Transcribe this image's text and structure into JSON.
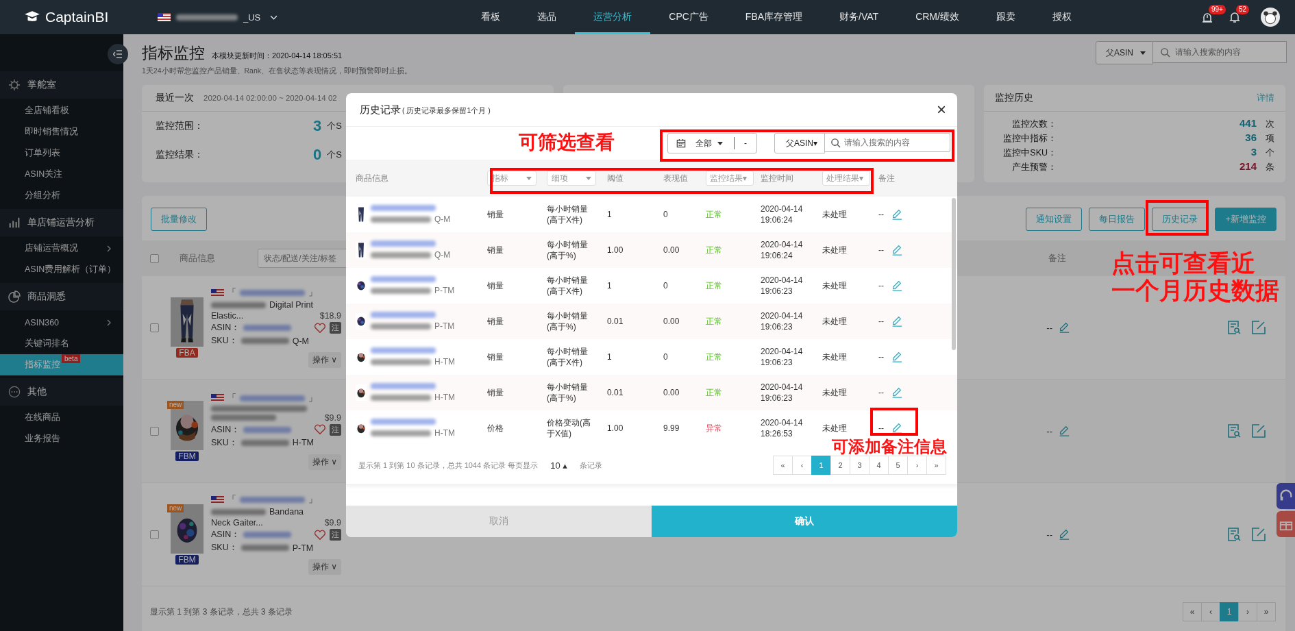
{
  "topbar": {
    "logo": "CaptainBI",
    "store_suffix": "_US",
    "nav": [
      {
        "label": "看板",
        "selected": false
      },
      {
        "label": "选品",
        "selected": false
      },
      {
        "label": "运营分析",
        "selected": true
      },
      {
        "label": "CPC广告",
        "selected": false
      },
      {
        "label": "FBA库存管理",
        "selected": false
      },
      {
        "label": "财务/VAT",
        "selected": false
      },
      {
        "label": "CRM/绩效",
        "selected": false
      },
      {
        "label": "跟卖",
        "selected": false
      },
      {
        "label": "授权",
        "selected": false
      }
    ],
    "badges": [
      "99+",
      "52"
    ]
  },
  "sidebar": {
    "groups": [
      {
        "label": "掌舵室",
        "kind": "helm",
        "children": [
          {
            "label": "全店铺看板",
            "selected": false,
            "expandable": false
          },
          {
            "label": "即时销售情况",
            "selected": false,
            "expandable": false
          },
          {
            "label": "订单列表",
            "selected": false,
            "expandable": false
          },
          {
            "label": "ASIN关注",
            "selected": false,
            "expandable": false
          },
          {
            "label": "分组分析",
            "selected": false,
            "expandable": false
          }
        ]
      },
      {
        "label": "单店铺运营分析",
        "kind": "bars",
        "children": [
          {
            "label": "店铺运营概况",
            "selected": false,
            "expandable": true
          },
          {
            "label": "ASIN费用解析（订单）",
            "selected": false,
            "expandable": false
          }
        ]
      },
      {
        "label": "商品洞悉",
        "kind": "pie",
        "children": [
          {
            "label": "ASIN360",
            "selected": false,
            "expandable": true
          },
          {
            "label": "关键词排名",
            "selected": false,
            "expandable": false
          },
          {
            "label": "指标监控",
            "selected": true,
            "expandable": false,
            "badge": "beta"
          }
        ]
      },
      {
        "label": "其他",
        "kind": "more",
        "children": [
          {
            "label": "在线商品",
            "selected": false,
            "expandable": false
          },
          {
            "label": "业务报告",
            "selected": false,
            "expandable": false
          }
        ]
      }
    ]
  },
  "header": {
    "title": "指标监控",
    "updated": "本模块更新时间：2020-04-14 18:05:51",
    "subtitle": "1天24小时帮您监控产品销量、Rank、在售状态等表现情况，即时预警即时止损。",
    "scope": "父ASIN",
    "placeholder": "请输入搜索的内容"
  },
  "latest_card": {
    "title": "最近一次",
    "range": "2020-04-14 02:00:00 ~ 2020-04-14 02",
    "stats": [
      {
        "label": "监控范围：",
        "value": "3",
        "unit": "个S"
      },
      {
        "label": "监控结果：",
        "value": "0",
        "unit": "个S"
      }
    ]
  },
  "history_card": {
    "title": "监控历史",
    "link": "详情",
    "stats": [
      {
        "label": "监控次数：",
        "value": "441",
        "unit": "次",
        "alert": false
      },
      {
        "label": "监控中指标：",
        "value": "36",
        "unit": "项",
        "alert": false
      },
      {
        "label": "监控中SKU：",
        "value": "3",
        "unit": "个",
        "alert": false
      },
      {
        "label": "产生预警：",
        "value": "214",
        "unit": "条",
        "alert": true
      }
    ]
  },
  "toolbar": {
    "batch": "批量修改",
    "actions": [
      {
        "label": "通知设置",
        "primary": false
      },
      {
        "label": "每日报告",
        "primary": false
      },
      {
        "label": "历史记录",
        "primary": false
      },
      {
        "label": "+新增监控",
        "primary": true
      }
    ]
  },
  "products": {
    "all_checked": false,
    "info_column": "商品信息",
    "filter": "状态/配送/关注/标签",
    "remark_column": "备注",
    "rows": [
      {
        "checked": false,
        "badge": {
          "label": "FBA",
          "kind": "fba"
        },
        "store_open": "「",
        "store_close": "」",
        "title": "Digital Print",
        "title_line2": "Elastic...",
        "price": "$18.9",
        "asin_label": "ASIN：",
        "sku_label": "SKU：",
        "sku_tail": "Q-M",
        "tag": "注",
        "menu": "操作 ∨",
        "remark": "--"
      },
      {
        "checked": false,
        "new_tag": "new",
        "badge": {
          "label": "FBM",
          "kind": "fbm"
        },
        "store_open": "「",
        "store_close": "」",
        "price": "$9.9",
        "asin_label": "ASIN：",
        "sku_label": "SKU：",
        "sku_tail": "H-TM",
        "tag": "注",
        "menu": "操作 ∨",
        "remark": "--"
      },
      {
        "checked": false,
        "new_tag": "new",
        "badge": {
          "label": "FBM",
          "kind": "fbm"
        },
        "store_open": "「",
        "store_close": "」",
        "title": "Bandana",
        "title_line2": "Neck Gaiter...",
        "price": "$9.9",
        "asin_label": "ASIN：",
        "sku_label": "SKU：",
        "sku_tail": "P-TM",
        "tag": "注",
        "menu": "操作 ∨",
        "remark": "--"
      }
    ],
    "summary": "显示第 1 到第 3 条记录，总共 3 条记录",
    "pager": {
      "first": "«",
      "prev": "‹",
      "pages": [
        {
          "label": "1",
          "selected": true
        }
      ],
      "next": "›",
      "last": "»"
    }
  },
  "modal": {
    "title": "历史记录",
    "note": "( 历史记录最多保留1个月 )",
    "close": "×",
    "date_value": "全部",
    "date_separator": "-",
    "scope": "父ASIN▾",
    "placeholder": "请输入搜索的内容",
    "columns": [
      {
        "label": "商品信息",
        "kind": "text"
      },
      {
        "label": "指标",
        "kind": "select"
      },
      {
        "label": "细项",
        "kind": "select"
      },
      {
        "label": "阈值",
        "kind": "text"
      },
      {
        "label": "表现值",
        "kind": "text"
      },
      {
        "label": "监控结果▾",
        "kind": "dropdown"
      },
      {
        "label": "监控时间",
        "kind": "text"
      },
      {
        "label": "处理结果▾",
        "kind": "dropdown"
      },
      {
        "label": "备注",
        "kind": "text"
      }
    ],
    "rows": [
      {
        "sku_tail": "Q-M",
        "metric": "销量",
        "detail": [
          "每小时销量",
          "(高于X件)"
        ],
        "threshold": "1",
        "actual": "0",
        "result": "正常",
        "alert": false,
        "time": "2020-04-14\n19:06:24",
        "status": "未处理",
        "remark": "--"
      },
      {
        "sku_tail": "Q-M",
        "metric": "销量",
        "detail": [
          "每小时销量",
          "(高于%)"
        ],
        "threshold": "1.00",
        "actual": "0.00",
        "result": "正常",
        "alert": false,
        "time": "2020-04-14\n19:06:24",
        "status": "未处理",
        "remark": "--"
      },
      {
        "sku_tail": "P-TM",
        "metric": "销量",
        "detail": [
          "每小时销量",
          "(高于X件)"
        ],
        "threshold": "1",
        "actual": "0",
        "result": "正常",
        "alert": false,
        "time": "2020-04-14\n19:06:23",
        "status": "未处理",
        "remark": "--"
      },
      {
        "sku_tail": "P-TM",
        "metric": "销量",
        "detail": [
          "每小时销量",
          "(高于%)"
        ],
        "threshold": "0.01",
        "actual": "0.00",
        "result": "正常",
        "alert": false,
        "time": "2020-04-14\n19:06:23",
        "status": "未处理",
        "remark": "--"
      },
      {
        "sku_tail": "H-TM",
        "metric": "销量",
        "detail": [
          "每小时销量",
          "(高于X件)"
        ],
        "threshold": "1",
        "actual": "0",
        "result": "正常",
        "alert": false,
        "time": "2020-04-14\n19:06:23",
        "status": "未处理",
        "remark": "--"
      },
      {
        "sku_tail": "H-TM",
        "metric": "销量",
        "detail": [
          "每小时销量",
          "(高于%)"
        ],
        "threshold": "0.01",
        "actual": "0.00",
        "result": "正常",
        "alert": false,
        "time": "2020-04-14\n19:06:23",
        "status": "未处理",
        "remark": "--"
      },
      {
        "sku_tail": "H-TM",
        "metric": "价格",
        "detail": [
          "价格变动(高",
          "于X值)"
        ],
        "threshold": "1.00",
        "actual": "9.99",
        "result": "异常",
        "alert": true,
        "time": "2020-04-14\n18:26:53",
        "status": "未处理",
        "remark": "--"
      }
    ],
    "summary": "显示第 1 到第 10 条记录，总共 1044 条记录 每页显示",
    "page_size": "10 ▴",
    "page_unit": "条记录",
    "pager": {
      "first": "«",
      "prev": "‹",
      "pages": [
        {
          "label": "1",
          "selected": true
        },
        {
          "label": "2",
          "selected": false
        },
        {
          "label": "3",
          "selected": false
        },
        {
          "label": "4",
          "selected": false
        },
        {
          "label": "5",
          "selected": false
        }
      ],
      "next": "›",
      "last": "»"
    },
    "cancel": "取消",
    "confirm": "确认"
  },
  "annotations": {
    "filter": "可筛选查看",
    "remark": "可添加备注信息",
    "history": [
      "点击可查看近",
      "一个月历史数据"
    ]
  }
}
